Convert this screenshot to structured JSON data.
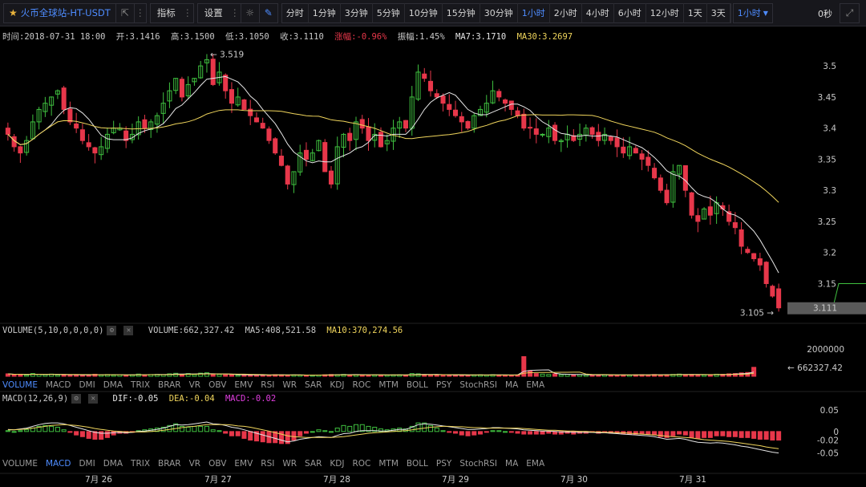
{
  "toolbar": {
    "symbol": "火币全球站-HT-USDT",
    "indicators_label": "指标",
    "settings_label": "设置",
    "intervals": [
      "分时",
      "1分钟",
      "3分钟",
      "5分钟",
      "10分钟",
      "15分钟",
      "30分钟",
      "1小时",
      "2小时",
      "4小时",
      "6小时",
      "12小时",
      "1天",
      "3天"
    ],
    "active_interval": "1小时",
    "dropdown_value": "1小时",
    "countdown": "0秒"
  },
  "info": {
    "time": "时间:2018-07-31 18:00",
    "open": "开:3.1416",
    "high": "高:3.1500",
    "low": "低:3.1050",
    "close": "收:3.1110",
    "change": "涨幅:-0.96%",
    "amplitude": "振幅:1.45%",
    "ma7": "MA7:3.1710",
    "ma30": "MA30:3.2697"
  },
  "volume_info": {
    "label": "VOLUME(5,10,0,0,0,0)",
    "volume": "VOLUME:662,327.42",
    "ma5": "MA5:408,521.58",
    "ma10": "MA10:370,274.56"
  },
  "macd_info": {
    "label": "MACD(12,26,9)",
    "dif": "DIF:-0.05",
    "dea": "DEA:-0.04",
    "macd": "MACD:-0.02"
  },
  "indicator_tabs": [
    "VOLUME",
    "MACD",
    "DMI",
    "DMA",
    "TRIX",
    "BRAR",
    "VR",
    "OBV",
    "EMV",
    "RSI",
    "WR",
    "SAR",
    "KDJ",
    "ROC",
    "MTM",
    "BOLL",
    "PSY",
    "StochRSI",
    "MA",
    "EMA"
  ],
  "colors": {
    "up": "#3fbf3f",
    "down": "#e7374a",
    "ma7": "#e6e6e6",
    "ma30": "#f0d55c",
    "accent": "#4e8cff",
    "macd_line": "#e13ee0"
  },
  "chart_data": {
    "type": "candlestick",
    "price_axis": {
      "ticks": [
        3.5,
        3.45,
        3.4,
        3.35,
        3.3,
        3.25,
        3.2,
        3.15
      ],
      "ylim": [
        3.09,
        3.535
      ]
    },
    "x_labels": [
      "7月 26",
      "7月 27",
      "7月 28",
      "7月 29",
      "7月 30",
      "7月 31"
    ],
    "annotations": {
      "high_label": "← 3.519",
      "low_label": "3.105 →",
      "last_price": "3.111"
    },
    "close_series": [
      3.39,
      3.37,
      3.36,
      3.38,
      3.41,
      3.43,
      3.44,
      3.45,
      3.46,
      3.43,
      3.41,
      3.4,
      3.38,
      3.37,
      3.36,
      3.37,
      3.39,
      3.4,
      3.4,
      3.38,
      3.39,
      3.41,
      3.4,
      3.41,
      3.42,
      3.44,
      3.46,
      3.48,
      3.45,
      3.47,
      3.48,
      3.5,
      3.51,
      3.47,
      3.49,
      3.46,
      3.44,
      3.45,
      3.43,
      3.42,
      3.41,
      3.4,
      3.38,
      3.36,
      3.34,
      3.31,
      3.33,
      3.36,
      3.35,
      3.36,
      3.38,
      3.33,
      3.31,
      3.37,
      3.39,
      3.38,
      3.41,
      3.4,
      3.38,
      3.39,
      3.37,
      3.38,
      3.4,
      3.41,
      3.4,
      3.45,
      3.49,
      3.48,
      3.46,
      3.45,
      3.44,
      3.43,
      3.42,
      3.41,
      3.4,
      3.42,
      3.43,
      3.44,
      3.46,
      3.45,
      3.44,
      3.43,
      3.42,
      3.4,
      3.4,
      3.39,
      3.39,
      3.4,
      3.38,
      3.38,
      3.39,
      3.38,
      3.39,
      3.4,
      3.39,
      3.38,
      3.39,
      3.38,
      3.37,
      3.36,
      3.37,
      3.36,
      3.35,
      3.34,
      3.32,
      3.3,
      3.28,
      3.33,
      3.34,
      3.3,
      3.26,
      3.25,
      3.27,
      3.26,
      3.28,
      3.27,
      3.25,
      3.24,
      3.21,
      3.2,
      3.19,
      3.18,
      3.15,
      3.13,
      3.111
    ],
    "volume_axis": {
      "tick": "2000000",
      "last_value": "← 662327.42"
    },
    "volume_values": [
      180000,
      120000,
      150000,
      90000,
      200000,
      140000,
      110000,
      160000,
      100000,
      130000,
      90000,
      120000,
      80000,
      110000,
      150000,
      100000,
      130000,
      90000,
      120000,
      80000,
      110000,
      160000,
      100000,
      130000,
      140000,
      120000,
      180000,
      220000,
      140000,
      200000,
      120000,
      230000,
      260000,
      120000,
      140000,
      110000,
      130000,
      90000,
      120000,
      80000,
      100000,
      70000,
      90000,
      120000,
      110000,
      80000,
      100000,
      90000,
      70000,
      80000,
      90000,
      110000,
      130000,
      120000,
      140000,
      100000,
      120000,
      110000,
      90000,
      100000,
      80000,
      90000,
      100000,
      110000,
      90000,
      200000,
      180000,
      120000,
      100000,
      110000,
      90000,
      80000,
      100000,
      90000,
      80000,
      100000,
      110000,
      90000,
      120000,
      100000,
      90000,
      80000,
      100000,
      1450000,
      420000,
      200000,
      160000,
      130000,
      180000,
      120000,
      140000,
      110000,
      120000,
      100000,
      90000,
      110000,
      120000,
      90000,
      80000,
      100000,
      90000,
      110000,
      120000,
      100000,
      130000,
      110000,
      120000,
      140000,
      160000,
      120000,
      130000,
      110000,
      100000,
      120000,
      150000,
      140000,
      180000,
      200000,
      250000,
      280000,
      662327
    ],
    "macd_axis": {
      "ticks": [
        "0.05",
        "0",
        "-0.02",
        "-0.05"
      ],
      "ylim": [
        -0.06,
        0.065
      ]
    },
    "macd_dif": [
      0.005,
      0.004,
      0.006,
      0.008,
      0.012,
      0.016,
      0.019,
      0.02,
      0.02,
      0.018,
      0.014,
      0.01,
      0.006,
      0.002,
      -0.002,
      -0.004,
      -0.004,
      -0.003,
      -0.002,
      -0.003,
      -0.002,
      0.0,
      0.001,
      0.003,
      0.005,
      0.008,
      0.012,
      0.016,
      0.015,
      0.016,
      0.018,
      0.02,
      0.022,
      0.018,
      0.017,
      0.014,
      0.01,
      0.008,
      0.004,
      0.0,
      -0.004,
      -0.008,
      -0.012,
      -0.016,
      -0.02,
      -0.024,
      -0.022,
      -0.018,
      -0.016,
      -0.014,
      -0.012,
      -0.013,
      -0.014,
      -0.009,
      -0.005,
      -0.004,
      0.0,
      0.002,
      0.002,
      0.002,
      0.001,
      0.001,
      0.003,
      0.005,
      0.005,
      0.01,
      0.016,
      0.018,
      0.017,
      0.015,
      0.013,
      0.011,
      0.009,
      0.007,
      0.005,
      0.005,
      0.006,
      0.007,
      0.009,
      0.009,
      0.008,
      0.007,
      0.006,
      0.004,
      0.003,
      0.002,
      0.001,
      0.001,
      0.0,
      -0.001,
      -0.001,
      -0.002,
      -0.002,
      -0.002,
      -0.002,
      -0.003,
      -0.003,
      -0.004,
      -0.005,
      -0.006,
      -0.007,
      -0.008,
      -0.009,
      -0.01,
      -0.012,
      -0.015,
      -0.018,
      -0.017,
      -0.016,
      -0.018,
      -0.022,
      -0.025,
      -0.026,
      -0.027,
      -0.026,
      -0.027,
      -0.029,
      -0.031,
      -0.034,
      -0.036,
      -0.039,
      -0.042,
      -0.045,
      -0.048,
      -0.05
    ],
    "macd_dea": [
      0.004,
      0.004,
      0.005,
      0.006,
      0.008,
      0.01,
      0.012,
      0.014,
      0.015,
      0.016,
      0.015,
      0.014,
      0.012,
      0.01,
      0.007,
      0.005,
      0.003,
      0.001,
      0.0,
      -0.001,
      -0.001,
      -0.001,
      -0.001,
      0.0,
      0.001,
      0.003,
      0.005,
      0.007,
      0.009,
      0.011,
      0.012,
      0.014,
      0.016,
      0.016,
      0.016,
      0.016,
      0.015,
      0.013,
      0.012,
      0.01,
      0.007,
      0.004,
      0.001,
      -0.003,
      -0.006,
      -0.01,
      -0.012,
      -0.013,
      -0.014,
      -0.014,
      -0.014,
      -0.014,
      -0.014,
      -0.013,
      -0.012,
      -0.01,
      -0.008,
      -0.006,
      -0.004,
      -0.003,
      -0.002,
      -0.001,
      0.0,
      0.001,
      0.002,
      0.004,
      0.006,
      0.008,
      0.01,
      0.011,
      0.012,
      0.012,
      0.011,
      0.011,
      0.01,
      0.009,
      0.009,
      0.008,
      0.008,
      0.008,
      0.008,
      0.008,
      0.008,
      0.007,
      0.006,
      0.005,
      0.004,
      0.003,
      0.003,
      0.002,
      0.001,
      0.001,
      0.0,
      0.0,
      -0.001,
      -0.001,
      -0.002,
      -0.002,
      -0.003,
      -0.003,
      -0.004,
      -0.005,
      -0.006,
      -0.007,
      -0.008,
      -0.009,
      -0.011,
      -0.012,
      -0.013,
      -0.014,
      -0.015,
      -0.017,
      -0.019,
      -0.02,
      -0.021,
      -0.022,
      -0.023,
      -0.025,
      -0.027,
      -0.029,
      -0.031,
      -0.033,
      -0.036,
      -0.038,
      -0.04
    ]
  }
}
